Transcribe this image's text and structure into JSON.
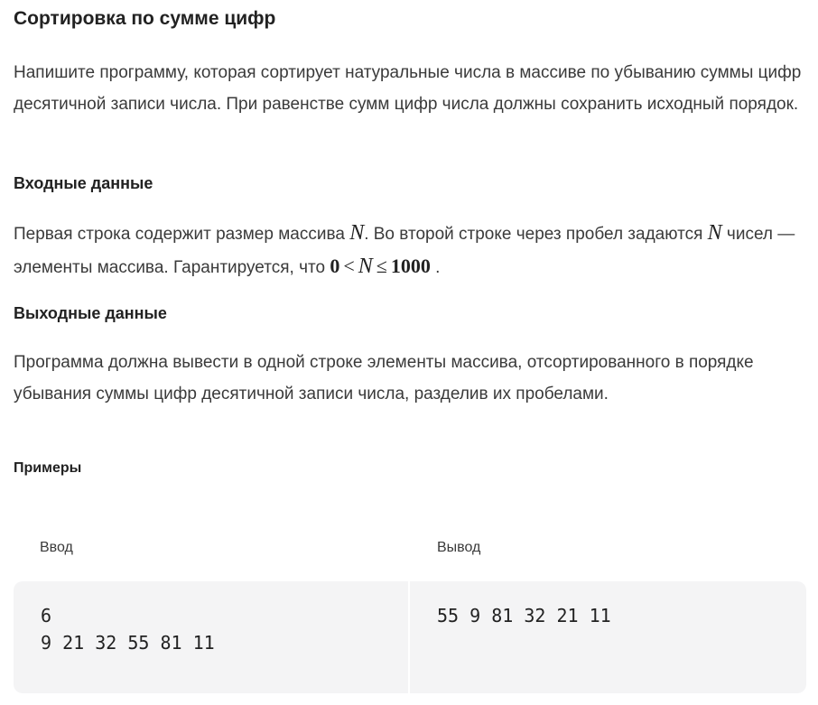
{
  "task": {
    "title": "Сортировка по сумме цифр",
    "description": "Напишите программу, которая сортирует натуральные числа в массиве по убыванию суммы цифр десятичной записи числа. При равенстве сумм цифр числа должны сохранить исходный порядок."
  },
  "input_section": {
    "heading": "Входные данные",
    "text_part1": "Первая строка содержит размер массива ",
    "var_n": "N",
    "text_part2": ". Во второй строке через пробел задаются ",
    "text_part3": " чисел — элементы массива. Гарантируется, что ",
    "constraint_zero": "0",
    "constraint_lt": "<",
    "constraint_le": "≤",
    "constraint_max": "1000",
    "text_part4": " ."
  },
  "output_section": {
    "heading": "Выходные данные",
    "text": "Программа должна вывести в одной строке элементы массива, отсортированного в порядке убывания суммы цифр десятичной записи числа, разделив их пробелами."
  },
  "examples": {
    "heading": "Примеры",
    "input_label": "Ввод",
    "output_label": "Вывод",
    "input_value": "6\n9 21 32 55 81 11",
    "output_value": "55 9 81 32 21 11"
  }
}
